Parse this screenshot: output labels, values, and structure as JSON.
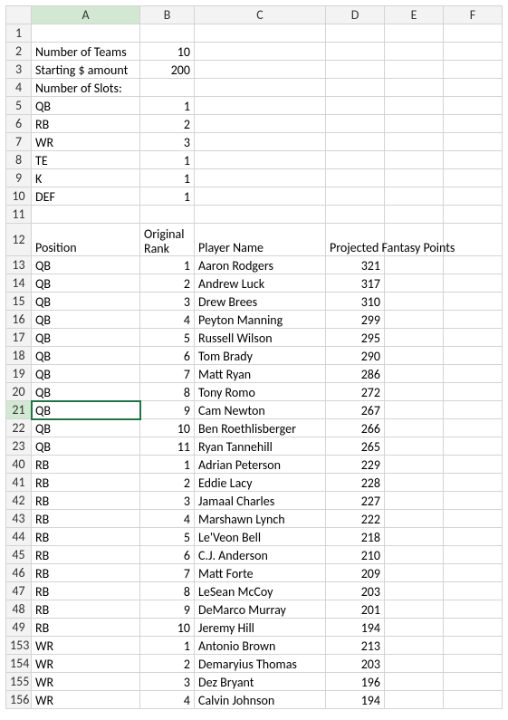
{
  "columns": [
    "A",
    "B",
    "C",
    "D",
    "E",
    "F"
  ],
  "selected_cell": {
    "row": 21,
    "col": "A"
  },
  "rows": [
    {
      "n": 1,
      "A": "",
      "B": "",
      "C": "",
      "D": "",
      "E": "",
      "F": ""
    },
    {
      "n": 2,
      "A": "Number of Teams",
      "B": 10,
      "C": "",
      "D": "",
      "E": "",
      "F": ""
    },
    {
      "n": 3,
      "A": "Starting $ amount",
      "B": 200,
      "C": "",
      "D": "",
      "E": "",
      "F": ""
    },
    {
      "n": 4,
      "A": "Number of Slots:",
      "B": "",
      "C": "",
      "D": "",
      "E": "",
      "F": ""
    },
    {
      "n": 5,
      "A": "QB",
      "B": 1,
      "C": "",
      "D": "",
      "E": "",
      "F": ""
    },
    {
      "n": 6,
      "A": "RB",
      "B": 2,
      "C": "",
      "D": "",
      "E": "",
      "F": ""
    },
    {
      "n": 7,
      "A": "WR",
      "B": 3,
      "C": "",
      "D": "",
      "E": "",
      "F": ""
    },
    {
      "n": 8,
      "A": "TE",
      "B": 1,
      "C": "",
      "D": "",
      "E": "",
      "F": ""
    },
    {
      "n": 9,
      "A": "K",
      "B": 1,
      "C": "",
      "D": "",
      "E": "",
      "F": ""
    },
    {
      "n": 10,
      "A": "DEF",
      "B": 1,
      "C": "",
      "D": "",
      "E": "",
      "F": ""
    },
    {
      "n": 11,
      "A": "",
      "B": "",
      "C": "",
      "D": "",
      "E": "",
      "F": ""
    },
    {
      "n": 12,
      "A": "Position",
      "B": "Original Rank",
      "Bwrap": true,
      "C": "Player Name",
      "D": "Projected Fantasy Points",
      "Doverflow": true,
      "E": "",
      "F": ""
    },
    {
      "n": 13,
      "A": "QB",
      "B": 1,
      "C": "Aaron Rodgers",
      "D": 321,
      "E": "",
      "F": ""
    },
    {
      "n": 14,
      "A": "QB",
      "B": 2,
      "C": "Andrew Luck",
      "D": 317,
      "E": "",
      "F": ""
    },
    {
      "n": 15,
      "A": "QB",
      "B": 3,
      "C": "Drew Brees",
      "D": 310,
      "E": "",
      "F": ""
    },
    {
      "n": 16,
      "A": "QB",
      "B": 4,
      "C": "Peyton Manning",
      "D": 299,
      "E": "",
      "F": ""
    },
    {
      "n": 17,
      "A": "QB",
      "B": 5,
      "C": "Russell Wilson",
      "D": 295,
      "E": "",
      "F": ""
    },
    {
      "n": 18,
      "A": "QB",
      "B": 6,
      "C": "Tom Brady",
      "D": 290,
      "E": "",
      "F": ""
    },
    {
      "n": 19,
      "A": "QB",
      "B": 7,
      "C": "Matt Ryan",
      "D": 286,
      "E": "",
      "F": ""
    },
    {
      "n": 20,
      "A": "QB",
      "B": 8,
      "C": "Tony Romo",
      "D": 272,
      "E": "",
      "F": ""
    },
    {
      "n": 21,
      "A": "QB",
      "B": 9,
      "C": "Cam Newton",
      "D": 267,
      "E": "",
      "F": ""
    },
    {
      "n": 22,
      "A": "QB",
      "B": 10,
      "C": "Ben Roethlisberger",
      "D": 266,
      "E": "",
      "F": ""
    },
    {
      "n": 23,
      "A": "QB",
      "B": 11,
      "C": "Ryan Tannehill",
      "D": 265,
      "E": "",
      "F": ""
    },
    {
      "n": 40,
      "A": "RB",
      "B": 1,
      "C": "Adrian Peterson",
      "D": 229,
      "E": "",
      "F": ""
    },
    {
      "n": 41,
      "A": "RB",
      "B": 2,
      "C": "Eddie Lacy",
      "D": 228,
      "E": "",
      "F": ""
    },
    {
      "n": 42,
      "A": "RB",
      "B": 3,
      "C": "Jamaal Charles",
      "D": 227,
      "E": "",
      "F": ""
    },
    {
      "n": 43,
      "A": "RB",
      "B": 4,
      "C": "Marshawn Lynch",
      "D": 222,
      "E": "",
      "F": ""
    },
    {
      "n": 44,
      "A": "RB",
      "B": 5,
      "C": "Le'Veon Bell",
      "D": 218,
      "E": "",
      "F": ""
    },
    {
      "n": 45,
      "A": "RB",
      "B": 6,
      "C": "C.J. Anderson",
      "D": 210,
      "E": "",
      "F": ""
    },
    {
      "n": 46,
      "A": "RB",
      "B": 7,
      "C": "Matt Forte",
      "D": 209,
      "E": "",
      "F": ""
    },
    {
      "n": 47,
      "A": "RB",
      "B": 8,
      "C": "LeSean McCoy",
      "D": 203,
      "E": "",
      "F": ""
    },
    {
      "n": 48,
      "A": "RB",
      "B": 9,
      "C": "DeMarco Murray",
      "D": 201,
      "E": "",
      "F": ""
    },
    {
      "n": 49,
      "A": "RB",
      "B": 10,
      "C": "Jeremy Hill",
      "D": 194,
      "E": "",
      "F": ""
    },
    {
      "n": 153,
      "A": "WR",
      "B": 1,
      "C": "Antonio Brown",
      "D": 213,
      "E": "",
      "F": ""
    },
    {
      "n": 154,
      "A": "WR",
      "B": 2,
      "C": "Demaryius Thomas",
      "D": 203,
      "E": "",
      "F": ""
    },
    {
      "n": 155,
      "A": "WR",
      "B": 3,
      "C": "Dez Bryant",
      "D": 196,
      "E": "",
      "F": ""
    },
    {
      "n": 156,
      "A": "WR",
      "B": 4,
      "C": "Calvin Johnson",
      "D": 194,
      "E": "",
      "F": ""
    }
  ]
}
